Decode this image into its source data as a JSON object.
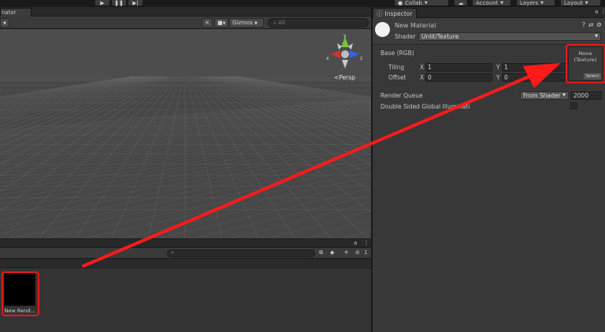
{
  "toolbar": {
    "play_icon": "play-icon",
    "pause_icon": "pause-icon",
    "step_icon": "step-icon",
    "collab_label": "Collab",
    "account_label": "Account",
    "layers_label": "Layers",
    "layout_label": "Layout"
  },
  "scene": {
    "tab_label": "nator",
    "gizmos_label": "Gizmos",
    "search_placeholder": "All",
    "persp_label": "Persp",
    "gizmo_x": "x",
    "gizmo_y": "y",
    "gizmo_z": "z"
  },
  "project": {
    "hidden_count": "1",
    "asset_label": "New Rend..."
  },
  "inspector": {
    "tab_label": "Inspector",
    "material_name": "New Material",
    "shader_label": "Shader",
    "shader_value": "Unlit/Texture",
    "base_label": "Base (RGB)",
    "tiling_label": "Tiling",
    "offset_label": "Offset",
    "axis_x": "X",
    "axis_y": "Y",
    "tiling_x": "1",
    "tiling_y": "1",
    "offset_x": "0",
    "offset_y": "0",
    "texture_none": "None",
    "texture_type": "(Texture)",
    "texture_select": "Select",
    "render_queue_label": "Render Queue",
    "render_queue_mode": "From Shader",
    "render_queue_value": "2000",
    "dsgi_label": "Double Sided Global Illuminati"
  },
  "colors": {
    "arrow": "#ff1a1a",
    "highlight": "#e01b1b",
    "gizmo_x": "#d6302e",
    "gizmo_y": "#7ac23a",
    "gizmo_z": "#2f63e8"
  }
}
